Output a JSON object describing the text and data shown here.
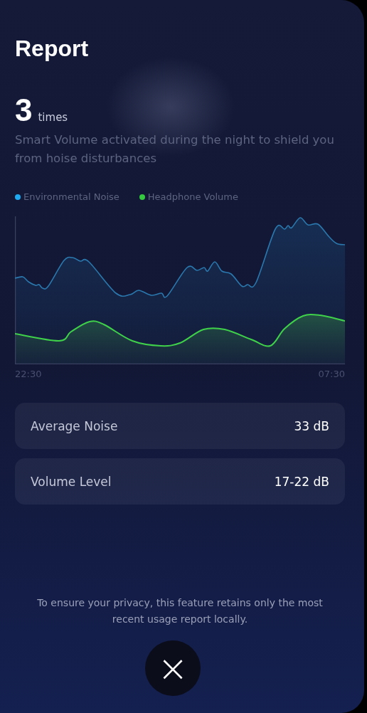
{
  "title": "Report",
  "count": {
    "value": "3",
    "unit": "times"
  },
  "description": "Smart Volume activated during the night to shield you from hoise disturbances",
  "legend": [
    {
      "label": "Environmental Noise",
      "color": "#1eaaf0"
    },
    {
      "label": "Headphone Volume",
      "color": "#35c93f"
    }
  ],
  "chart": {
    "kind": "picture",
    "x_labels": [
      "22:30",
      "07:30"
    ]
  },
  "stats": [
    {
      "label": "Average Noise",
      "value": "33 dB"
    },
    {
      "label": "Volume Level",
      "value": "17-22 dB"
    }
  ],
  "privacy_note": "To ensure your privacy, this feature retains only the most recent usage report locally.",
  "close_button": {
    "label": "×"
  }
}
